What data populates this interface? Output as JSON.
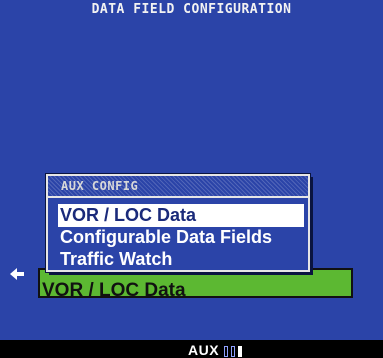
{
  "screen": {
    "title": "DATA FIELD CONFIGURATION",
    "colors": {
      "background": "#2b44a8",
      "field_highlight": "#5cb832",
      "selection": "#ffffff"
    }
  },
  "behind_field": {
    "text": "VOR / LOC Data"
  },
  "left_arrow": {
    "icon": "arrow-left-icon"
  },
  "popup": {
    "header": "AUX CONFIG",
    "items": [
      {
        "label": "VOR / LOC Data",
        "selected": true
      },
      {
        "label": "Configurable Data Fields",
        "selected": false
      },
      {
        "label": "Traffic Watch",
        "selected": false
      }
    ]
  },
  "bottom_bar": {
    "page_group": "AUX",
    "page_count": 3,
    "active_page": 3
  }
}
